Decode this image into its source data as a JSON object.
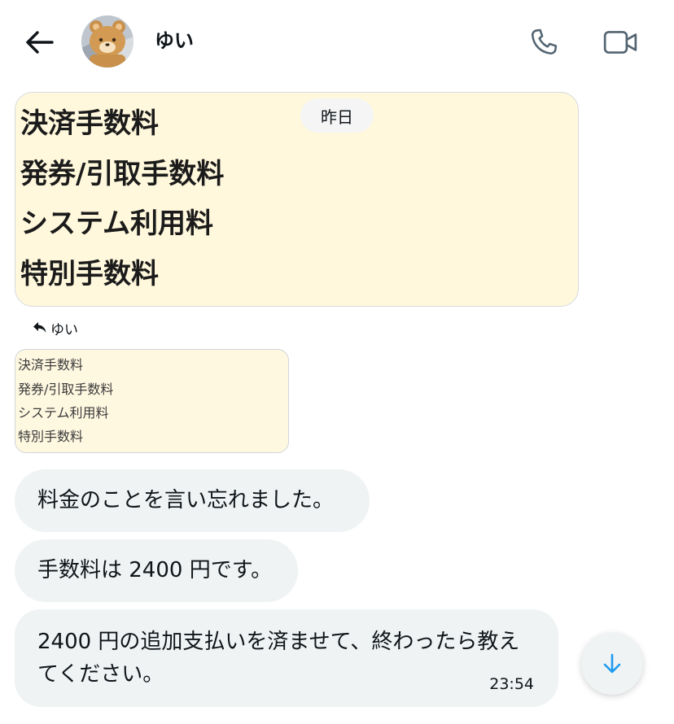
{
  "header": {
    "contact_name": "ゆい",
    "back_icon": "arrow-left-icon",
    "call_icon": "phone-icon",
    "video_icon": "video-camera-icon"
  },
  "conversation": {
    "date_separator": "昨日",
    "image_message": {
      "lines": [
        "決済手数料",
        "発券/引取手数料",
        "システム利用料",
        "特別手数料"
      ]
    },
    "reply": {
      "label": "ゆい",
      "icon": "reply-arrow-icon",
      "quoted_lines": [
        "決済手数料",
        "発券/引取手数料",
        "システム利用料",
        "特別手数料"
      ]
    },
    "messages": [
      {
        "text": "料金のことを言い忘れました。"
      },
      {
        "text": "手数料は 2400 円です。"
      },
      {
        "text": "2400 円の追加支払いを済ませて、終わったら教えてください。",
        "time": "23:54"
      }
    ]
  },
  "scroll_button": {
    "icon": "arrow-down-icon"
  },
  "colors": {
    "bubble_bg": "#eff3f4",
    "image_bg": "#fff8dc",
    "accent": "#1d9bf0",
    "text": "#0f1419"
  }
}
